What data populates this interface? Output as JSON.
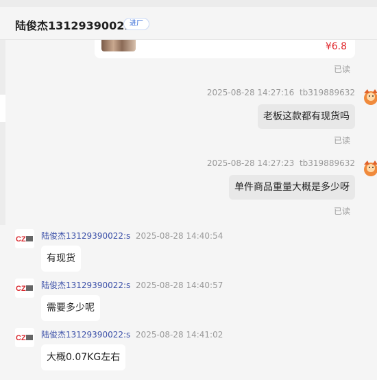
{
  "header": {
    "title": "陆俊杰13129390022",
    "tag": "进厂"
  },
  "product": {
    "price": "¥6.8",
    "read_status": "已读"
  },
  "messages": [
    {
      "direction": "out",
      "timestamp": "2025-08-28 14:27:16",
      "sender": "tb319889632",
      "text": "老板这款都有现货吗",
      "read_status": "已读"
    },
    {
      "direction": "out",
      "timestamp": "2025-08-28 14:27:23",
      "sender": "tb319889632",
      "text": "单件商品重量大概是多少呀",
      "read_status": "已读"
    },
    {
      "direction": "in",
      "sender": "陆俊杰13129390022:s",
      "timestamp": "2025-08-28 14:40:54",
      "text": "有现货"
    },
    {
      "direction": "in",
      "sender": "陆俊杰13129390022:s",
      "timestamp": "2025-08-28 14:40:57",
      "text": "需要多少呢"
    },
    {
      "direction": "in",
      "sender": "陆俊杰13129390022:s",
      "timestamp": "2025-08-28 14:41:02",
      "text": "大概0.07KG左右"
    }
  ],
  "colors": {
    "accent": "#3a4fa8",
    "price": "#e0262b",
    "background": "#f5f5f5",
    "outgoing_bubble": "#e8e8e8",
    "incoming_bubble": "#ffffff"
  },
  "icons": {
    "seller_avatar": "cz-logo-icon",
    "buyer_avatar": "cartoon-avatar-icon"
  }
}
